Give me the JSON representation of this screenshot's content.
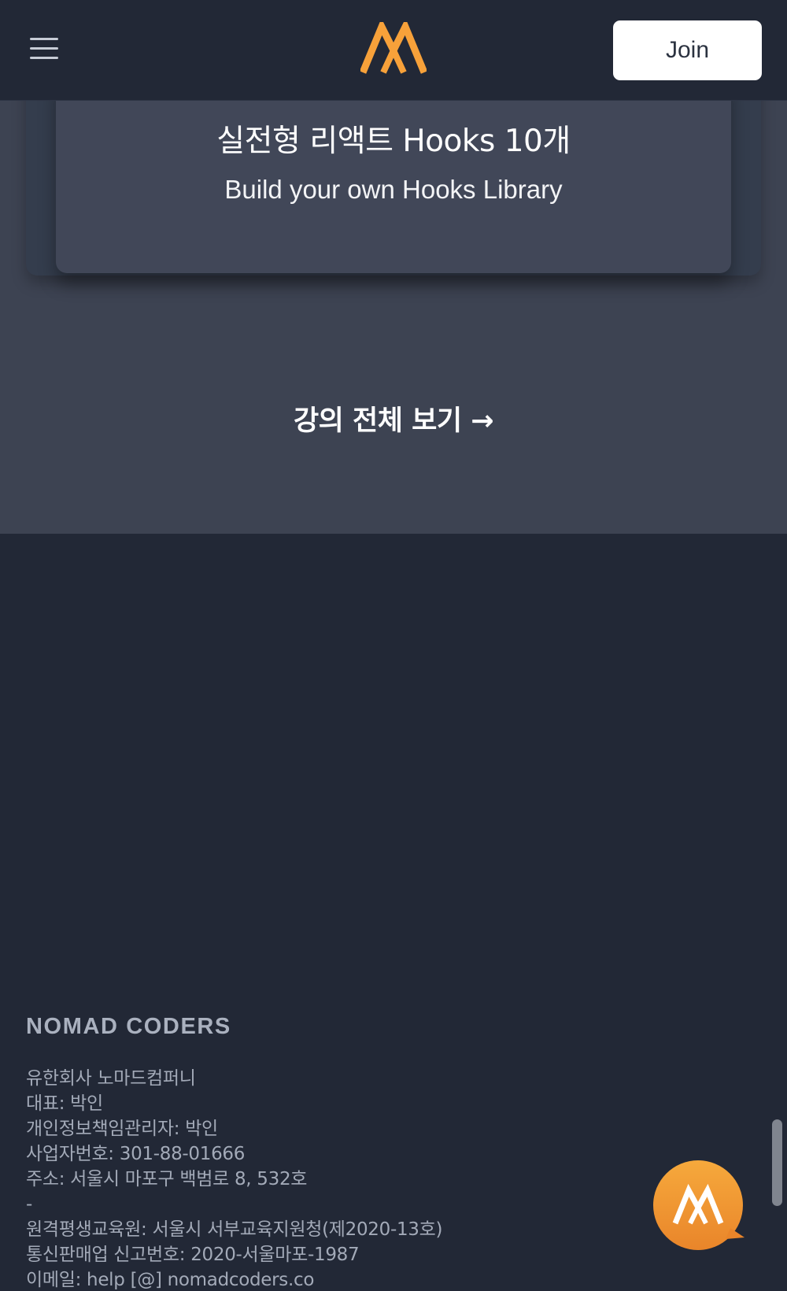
{
  "header": {
    "join_label": "Join",
    "logo_icon": "nomad-coders-logo",
    "menu_icon": "hamburger-menu-icon",
    "accent_color": "#F7A13A"
  },
  "course": {
    "title": "실전형 리액트 Hooks 10개",
    "subtitle": "Build your own Hooks Library"
  },
  "view_all_label": "강의 전체 보기 →",
  "footer": {
    "brand": "NOMAD CODERS",
    "lines": [
      "유한회사 노마드컴퍼니",
      "대표: 박인",
      "개인정보책임관리자: 박인",
      "사업자번호: 301-88-01666",
      "주소: 서울시 마포구 백범로 8, 532호",
      "-",
      "원격평생교육원: 서울시 서부교육지원청(제2020-13호)",
      "통신판매업 신고번호: 2020-서울마포-1987",
      "이메일: help [@] nomadcoders.co"
    ]
  },
  "chat_icon": "chat-bubble-logo-icon"
}
